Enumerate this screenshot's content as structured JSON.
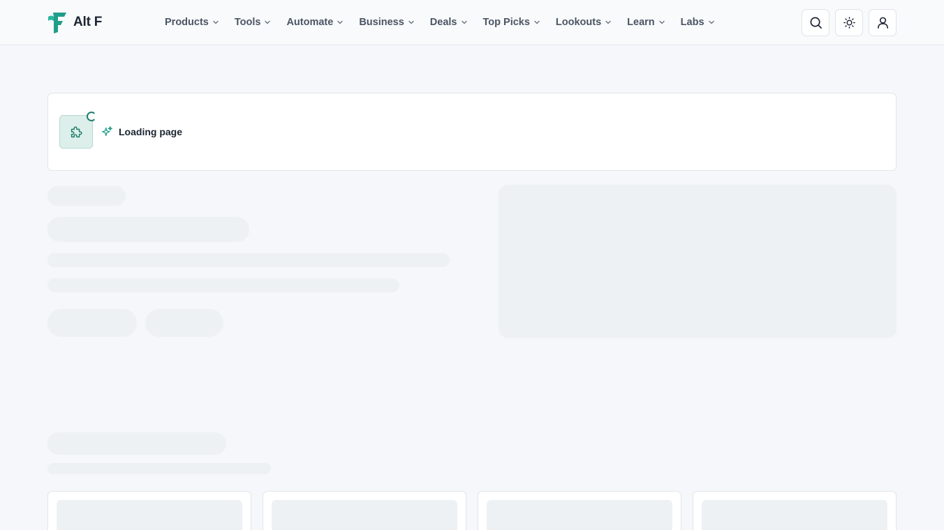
{
  "brand": {
    "name": "Alt F",
    "accent": "#1f9e8a",
    "accent_dark": "#1f7d6e"
  },
  "nav": {
    "items": [
      {
        "label": "Products",
        "icon": "chevron-down-icon"
      },
      {
        "label": "Tools",
        "icon": "chevron-down-icon"
      },
      {
        "label": "Automate",
        "icon": "chevron-down-icon"
      },
      {
        "label": "Business",
        "icon": "chevron-down-icon"
      },
      {
        "label": "Deals",
        "icon": "chevron-down-icon"
      },
      {
        "label": "Top Picks",
        "icon": "chevron-down-icon"
      },
      {
        "label": "Lookouts",
        "icon": "chevron-down-icon"
      },
      {
        "label": "Learn",
        "icon": "chevron-down-icon"
      },
      {
        "label": "Labs",
        "icon": "chevron-down-icon"
      }
    ]
  },
  "header_actions": {
    "search_icon": "search-icon",
    "theme_icon": "sun-icon",
    "account_icon": "user-icon"
  },
  "loading": {
    "label": "Loading page",
    "plugin_icon": "puzzle-icon",
    "sparkle_icon": "sparkle-icon"
  }
}
